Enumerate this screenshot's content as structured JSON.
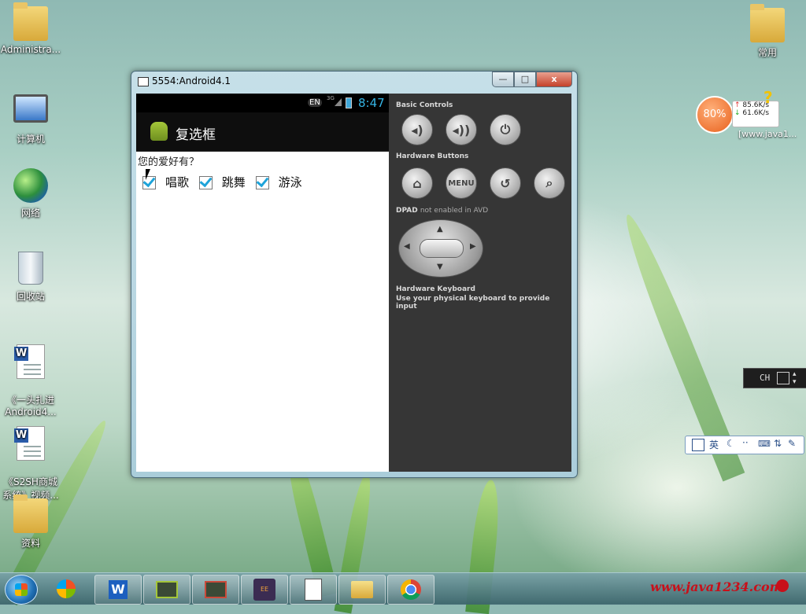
{
  "desktop": {
    "icons_left": [
      {
        "label": "Administra...",
        "icon": "user-folder-icon"
      },
      {
        "label": "计算机",
        "icon": "computer-icon"
      },
      {
        "label": "网络",
        "icon": "network-icon"
      },
      {
        "label": "回收站",
        "icon": "recycle-bin-icon"
      },
      {
        "label": "《一头扎进\nAndroid4...",
        "icon": "word-document-icon"
      },
      {
        "label": "《S2SH商城\n系统》视频...",
        "icon": "word-document-icon"
      },
      {
        "label": "资料",
        "icon": "folder-icon"
      }
    ],
    "icon_right": {
      "label": "常用",
      "icon": "folder-icon"
    }
  },
  "emulator_window": {
    "title": "5554:Android4.1",
    "buttons": {
      "minimize": "—",
      "maximize": "□",
      "close": "x"
    }
  },
  "android": {
    "status_bar": {
      "lang": "EN",
      "signal": "3G",
      "time": "8:47"
    },
    "action_bar_title": "复选框",
    "question": "您的爱好有？",
    "checkboxes": [
      {
        "label": "唱歌",
        "checked": true
      },
      {
        "label": "跳舞",
        "checked": true
      },
      {
        "label": "游泳",
        "checked": true
      }
    ]
  },
  "controls_panel": {
    "basic_controls": "Basic Controls",
    "hardware_buttons": "Hardware Buttons",
    "menu_label": "MENU",
    "dpad_title": "DPAD",
    "dpad_note": "not enabled in AVD",
    "keyboard_title": "Hardware Keyboard",
    "keyboard_note": "Use your physical keyboard to provide input"
  },
  "net_widget": {
    "percent": "80%",
    "up": "85.6K/s",
    "down": "61.6K/s",
    "caption": "[www.java1..."
  },
  "ime_bar": {
    "lang": "CH"
  },
  "ime_toolbar": {
    "mode": "英"
  },
  "taskbar": {
    "watermark": "www.java1234.com",
    "items": [
      "windows-logo-icon",
      "wps-writer-icon",
      "android-sdk-icon",
      "android-emulator-icon",
      "java-ee-ide-icon",
      "notepad-icon",
      "file-explorer-icon",
      "chrome-icon"
    ]
  },
  "colors": {
    "checkbox_check": "#1ea3d9",
    "panel_bg": "#363636",
    "status_bar_bg": "#000000"
  }
}
